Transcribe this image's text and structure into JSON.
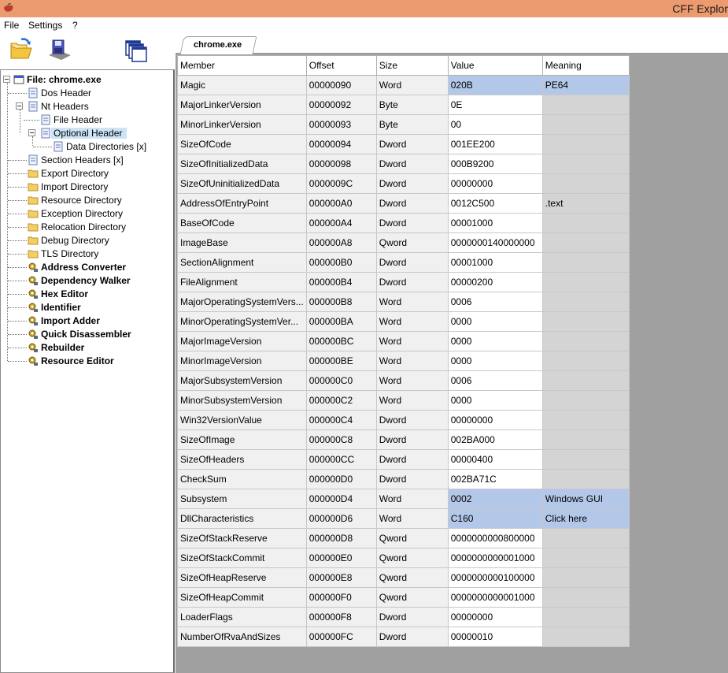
{
  "window": {
    "title": "CFF Explor"
  },
  "menu": {
    "file": "File",
    "settings": "Settings",
    "help": "?"
  },
  "toolbar": {
    "open_icon": "folder-open-icon",
    "save_icon": "save-icon",
    "windows_icon": "cascade-windows-icon"
  },
  "tab": {
    "label": "chrome.exe"
  },
  "tree": {
    "root": "File: chrome.exe",
    "dos_header": "Dos Header",
    "nt_headers": "Nt Headers",
    "file_header": "File Header",
    "optional_header": "Optional Header",
    "data_directories": "Data Directories [x]",
    "section_headers": "Section Headers [x]",
    "export_directory": "Export Directory",
    "import_directory": "Import Directory",
    "resource_directory": "Resource Directory",
    "exception_directory": "Exception Directory",
    "relocation_directory": "Relocation Directory",
    "debug_directory": "Debug Directory",
    "tls_directory": "TLS Directory",
    "address_converter": "Address Converter",
    "dependency_walker": "Dependency Walker",
    "hex_editor": "Hex Editor",
    "identifier": "Identifier",
    "import_adder": "Import Adder",
    "quick_disassembler": "Quick Disassembler",
    "rebuilder": "Rebuilder",
    "resource_editor": "Resource Editor"
  },
  "grid": {
    "columns": [
      "Member",
      "Offset",
      "Size",
      "Value",
      "Meaning"
    ],
    "rows": [
      {
        "member": "Magic",
        "offset": "00000090",
        "size": "Word",
        "value": "020B",
        "meaning": "PE64"
      },
      {
        "member": "MajorLinkerVersion",
        "offset": "00000092",
        "size": "Byte",
        "value": "0E",
        "meaning": ""
      },
      {
        "member": "MinorLinkerVersion",
        "offset": "00000093",
        "size": "Byte",
        "value": "00",
        "meaning": ""
      },
      {
        "member": "SizeOfCode",
        "offset": "00000094",
        "size": "Dword",
        "value": "001EE200",
        "meaning": ""
      },
      {
        "member": "SizeOfInitializedData",
        "offset": "00000098",
        "size": "Dword",
        "value": "000B9200",
        "meaning": ""
      },
      {
        "member": "SizeOfUninitializedData",
        "offset": "0000009C",
        "size": "Dword",
        "value": "00000000",
        "meaning": ""
      },
      {
        "member": "AddressOfEntryPoint",
        "offset": "000000A0",
        "size": "Dword",
        "value": "0012C500",
        "meaning": ".text"
      },
      {
        "member": "BaseOfCode",
        "offset": "000000A4",
        "size": "Dword",
        "value": "00001000",
        "meaning": ""
      },
      {
        "member": "ImageBase",
        "offset": "000000A8",
        "size": "Qword",
        "value": "0000000140000000",
        "meaning": ""
      },
      {
        "member": "SectionAlignment",
        "offset": "000000B0",
        "size": "Dword",
        "value": "00001000",
        "meaning": ""
      },
      {
        "member": "FileAlignment",
        "offset": "000000B4",
        "size": "Dword",
        "value": "00000200",
        "meaning": ""
      },
      {
        "member": "MajorOperatingSystemVers...",
        "offset": "000000B8",
        "size": "Word",
        "value": "0006",
        "meaning": ""
      },
      {
        "member": "MinorOperatingSystemVer...",
        "offset": "000000BA",
        "size": "Word",
        "value": "0000",
        "meaning": ""
      },
      {
        "member": "MajorImageVersion",
        "offset": "000000BC",
        "size": "Word",
        "value": "0000",
        "meaning": ""
      },
      {
        "member": "MinorImageVersion",
        "offset": "000000BE",
        "size": "Word",
        "value": "0000",
        "meaning": ""
      },
      {
        "member": "MajorSubsystemVersion",
        "offset": "000000C0",
        "size": "Word",
        "value": "0006",
        "meaning": ""
      },
      {
        "member": "MinorSubsystemVersion",
        "offset": "000000C2",
        "size": "Word",
        "value": "0000",
        "meaning": ""
      },
      {
        "member": "Win32VersionValue",
        "offset": "000000C4",
        "size": "Dword",
        "value": "00000000",
        "meaning": ""
      },
      {
        "member": "SizeOfImage",
        "offset": "000000C8",
        "size": "Dword",
        "value": "002BA000",
        "meaning": ""
      },
      {
        "member": "SizeOfHeaders",
        "offset": "000000CC",
        "size": "Dword",
        "value": "00000400",
        "meaning": ""
      },
      {
        "member": "CheckSum",
        "offset": "000000D0",
        "size": "Dword",
        "value": "002BA71C",
        "meaning": ""
      },
      {
        "member": "Subsystem",
        "offset": "000000D4",
        "size": "Word",
        "value": "0002",
        "meaning": "Windows GUI"
      },
      {
        "member": "DllCharacteristics",
        "offset": "000000D6",
        "size": "Word",
        "value": "C160",
        "meaning": "Click here"
      },
      {
        "member": "SizeOfStackReserve",
        "offset": "000000D8",
        "size": "Qword",
        "value": "0000000000800000",
        "meaning": ""
      },
      {
        "member": "SizeOfStackCommit",
        "offset": "000000E0",
        "size": "Qword",
        "value": "0000000000001000",
        "meaning": ""
      },
      {
        "member": "SizeOfHeapReserve",
        "offset": "000000E8",
        "size": "Qword",
        "value": "0000000000100000",
        "meaning": ""
      },
      {
        "member": "SizeOfHeapCommit",
        "offset": "000000F0",
        "size": "Qword",
        "value": "0000000000001000",
        "meaning": ""
      },
      {
        "member": "LoaderFlags",
        "offset": "000000F8",
        "size": "Dword",
        "value": "00000000",
        "meaning": ""
      },
      {
        "member": "NumberOfRvaAndSizes",
        "offset": "000000FC",
        "size": "Dword",
        "value": "00000010",
        "meaning": ""
      }
    ]
  },
  "colors": {
    "titlebar": "#ec9a6f",
    "selection": "#cce4f7",
    "highlight_row": "#b3c8e8"
  }
}
